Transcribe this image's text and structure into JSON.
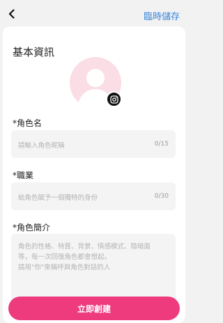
{
  "header": {
    "back_icon": "chevron-left-icon",
    "save_draft_label": "臨時儲存",
    "link_color": "#3a86d9"
  },
  "basic_info": {
    "title": "基本資訊",
    "avatar_icon": "user-silhouette-icon",
    "camera_icon": "instagram-camera-icon"
  },
  "form": {
    "name": {
      "label": "*角色名",
      "placeholder": "請輸入角色昵稱",
      "counter": "0/15"
    },
    "occupation": {
      "label": "*職業",
      "placeholder": "給角色賦予一個獨特的身份",
      "counter": "0/30"
    },
    "intro": {
      "label": "*角色簡介",
      "placeholder_lines": [
        "角色的性格、特質、背景、情感模式、隐暗面",
        "等，每一次回復角色都會想起。",
        "請用\"你\"來稱呼與角色對話的人"
      ]
    }
  },
  "submit": {
    "label": "立即創建",
    "color": "#ee3b7d"
  }
}
